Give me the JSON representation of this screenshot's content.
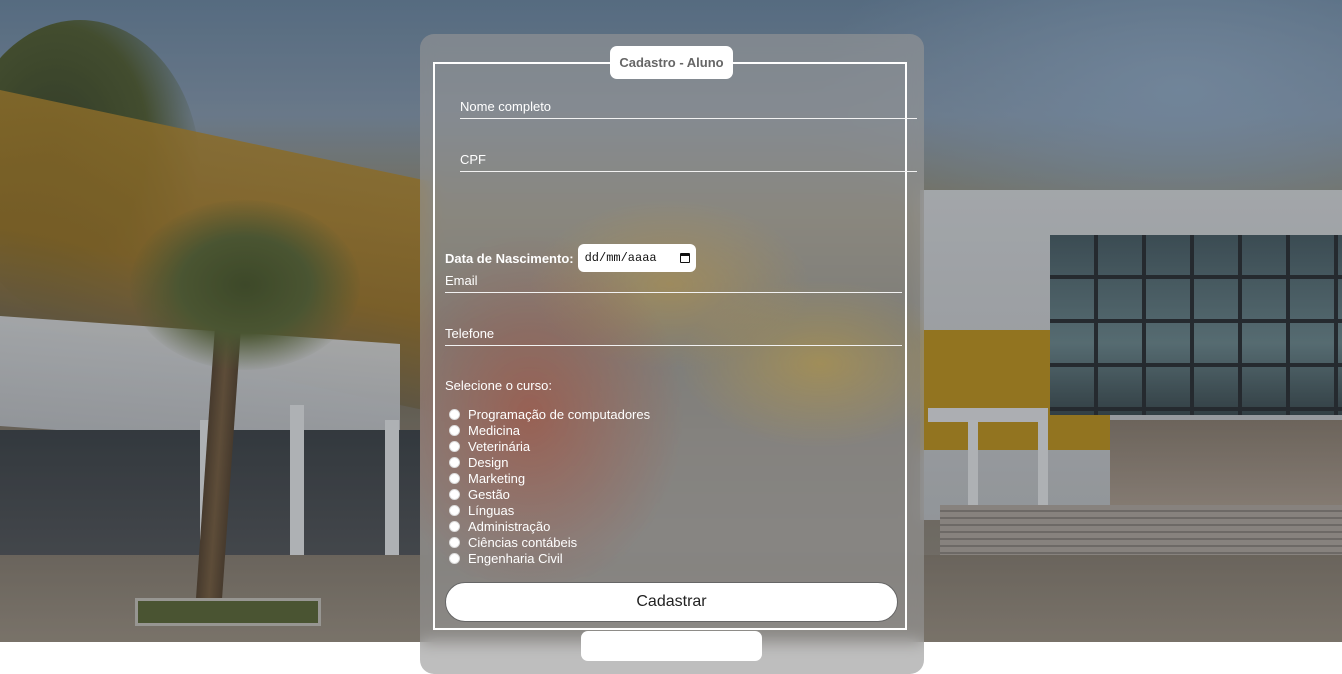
{
  "form": {
    "legend": "Cadastro - Aluno",
    "fields": {
      "nome_placeholder": "Nome completo",
      "cpf_placeholder": "CPF",
      "email_placeholder": "Email",
      "telefone_placeholder": "Telefone"
    },
    "birth_date": {
      "label": "Data de Nascimento:",
      "placeholder": "dd/mm/aaaa"
    },
    "course_label": "Selecione o curso:",
    "courses": [
      "Programação de computadores",
      "Medicina",
      "Veterinária",
      "Design",
      "Marketing",
      "Gestão",
      "Línguas",
      "Administração",
      "Ciências contábeis",
      "Engenharia Civil"
    ],
    "submit_label": "Cadastrar"
  },
  "colors": {
    "panel": "#969696",
    "border": "#ffffff",
    "legend_text": "#666666"
  }
}
